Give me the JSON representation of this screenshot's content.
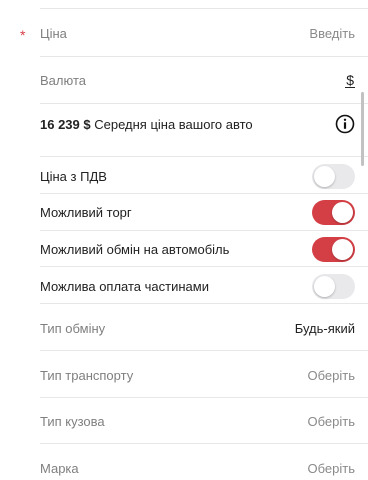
{
  "price": {
    "label": "Ціна",
    "placeholder": "Введіть"
  },
  "currency": {
    "label": "Валюта",
    "value": "$"
  },
  "average": {
    "amount": "16 239 $",
    "text": "Середня ціна вашого авто"
  },
  "toggles": [
    {
      "label": "Ціна з ПДВ",
      "state": "off"
    },
    {
      "label": "Можливий торг",
      "state": "on"
    },
    {
      "label": "Можливий обмін на автомобіль",
      "state": "on"
    },
    {
      "label": "Можлива оплата частинами",
      "state": "off"
    }
  ],
  "exchange_type": {
    "label": "Тип обміну",
    "value": "Будь-який"
  },
  "transport_type": {
    "label": "Тип транспорту",
    "value": "Оберіть"
  },
  "body_type": {
    "label": "Тип кузова",
    "value": "Оберіть"
  },
  "brand": {
    "label": "Марка",
    "value": "Оберіть"
  },
  "colors": {
    "accent": "#d43f45",
    "divider": "#e7e7e7"
  }
}
